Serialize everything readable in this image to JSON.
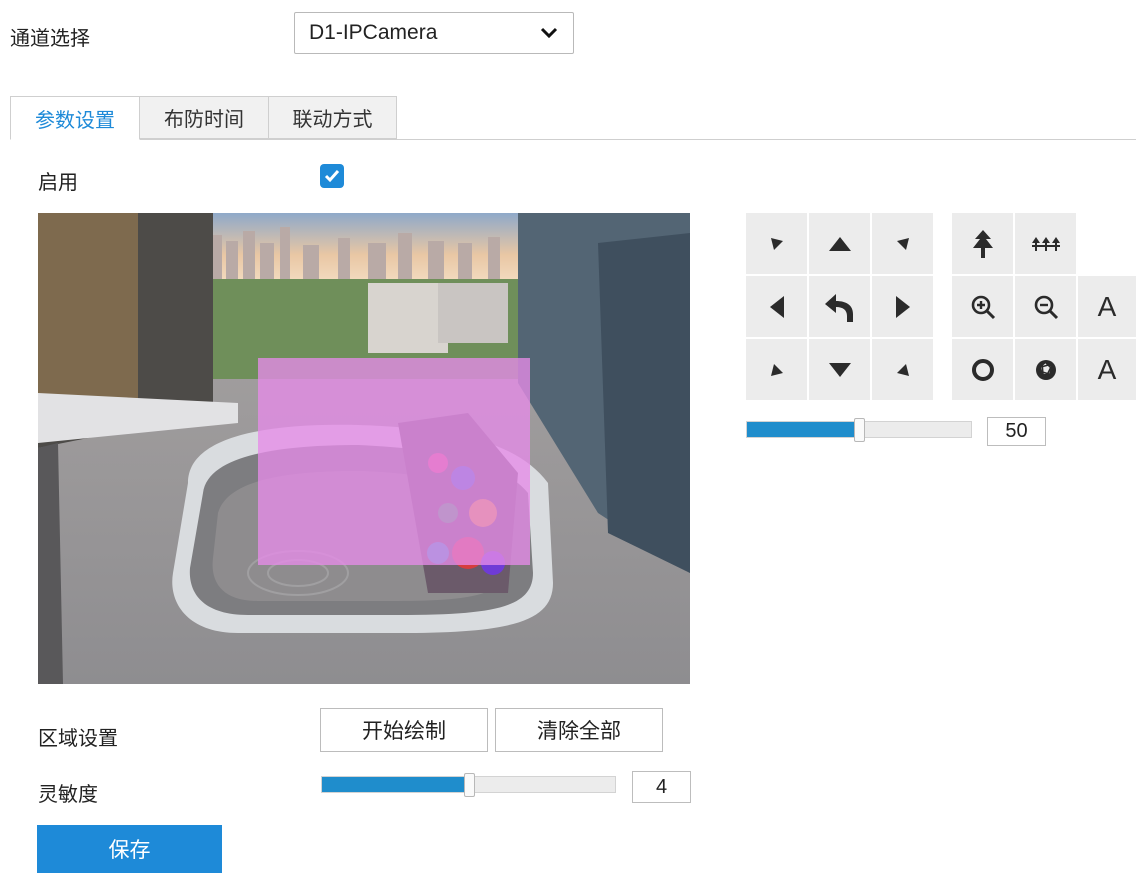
{
  "channel": {
    "label": "通道选择",
    "selected": "D1-IPCamera"
  },
  "tabs": [
    {
      "label": "参数设置",
      "active": true
    },
    {
      "label": "布防时间",
      "active": false
    },
    {
      "label": "联动方式",
      "active": false
    }
  ],
  "enable": {
    "label": "启用",
    "checked": true
  },
  "ptz": {
    "buttons": [
      {
        "name": "up-left",
        "icon": "arrow-up-left-icon"
      },
      {
        "name": "up",
        "icon": "arrow-up-icon"
      },
      {
        "name": "up-right",
        "icon": "arrow-up-right-icon"
      },
      {
        "name": "focus-near",
        "icon": "tree-icon"
      },
      {
        "name": "focus-far",
        "icon": "forest-icon"
      },
      {
        "name": "left",
        "icon": "arrow-left-icon"
      },
      {
        "name": "home",
        "icon": "undo-icon"
      },
      {
        "name": "right",
        "icon": "arrow-right-icon"
      },
      {
        "name": "zoom-in",
        "icon": "zoom-in-icon"
      },
      {
        "name": "zoom-out",
        "icon": "zoom-out-icon"
      },
      {
        "name": "down-left",
        "icon": "arrow-down-left-icon"
      },
      {
        "name": "down",
        "icon": "arrow-down-icon"
      },
      {
        "name": "down-right",
        "icon": "arrow-down-right-icon"
      },
      {
        "name": "iris-open",
        "icon": "aperture-open-icon"
      },
      {
        "name": "iris-close",
        "icon": "aperture-close-icon"
      }
    ],
    "letter_a1": "A",
    "letter_a2": "A",
    "speed_value": "50",
    "speed_fraction": 0.5
  },
  "region": {
    "label": "区域设置",
    "start_draw": "开始绘制",
    "clear_all": "清除全部"
  },
  "sensitivity": {
    "label": "灵敏度",
    "value": "4",
    "fraction": 0.5
  },
  "save_label": "保存",
  "colors": {
    "accent": "#1e8ad8",
    "slider": "#1f8dcc",
    "mask_region": "#e58ce8"
  }
}
